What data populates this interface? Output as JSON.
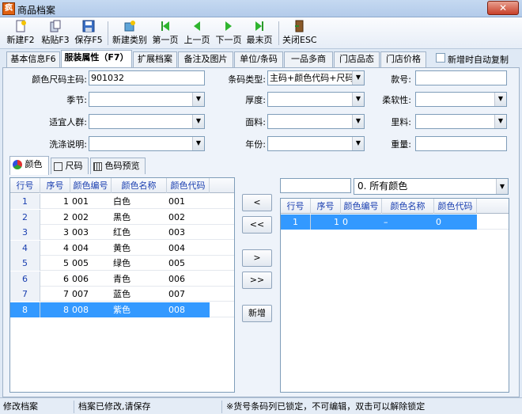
{
  "window": {
    "title": "商品档案",
    "app_icon": "疯",
    "close": "✕"
  },
  "toolbar": {
    "buttons": [
      {
        "label": "新建F2",
        "icon": "new-doc-icon"
      },
      {
        "label": "粘贴F3",
        "icon": "paste-icon"
      },
      {
        "label": "保存F5",
        "icon": "save-icon"
      },
      {
        "label": "新建类别",
        "icon": "new-category-icon"
      },
      {
        "label": "第一页",
        "icon": "first-page-icon"
      },
      {
        "label": "上一页",
        "icon": "prev-page-icon"
      },
      {
        "label": "下一页",
        "icon": "next-page-icon"
      },
      {
        "label": "最末页",
        "icon": "last-page-icon"
      },
      {
        "label": "关闭ESC",
        "icon": "close-door-icon"
      }
    ]
  },
  "tabs": [
    "基本信息F6",
    "服装属性（F7）",
    "扩展档案",
    "备注及图片",
    "单位/条码",
    "一品多商",
    "门店品态",
    "门店价格"
  ],
  "auto_copy_label": "新增时自动复制",
  "form": {
    "color_size_code_label": "颜色尺码主码:",
    "color_size_code_value": "901032",
    "barcode_type_label": "条码类型:",
    "barcode_type_value": "主码+颜色代码+尺码",
    "style_no_label": "款号:",
    "season_label": "季节:",
    "thickness_label": "厚度:",
    "softness_label": "柔软性:",
    "audience_label": "适宜人群:",
    "fabric_label": "面料:",
    "lining_label": "里料:",
    "wash_label": "洗涤说明:",
    "year_label": "年份:",
    "weight_label": "重量:"
  },
  "subtabs": [
    {
      "label": "颜色",
      "icon": "color-palette-icon"
    },
    {
      "label": "尺码",
      "icon": "ruler-icon"
    },
    {
      "label": "色码预览",
      "icon": "grid-preview-icon"
    }
  ],
  "left_grid": {
    "headers": [
      "行号",
      "序号",
      "颜色编号",
      "颜色名称",
      "颜色代码"
    ],
    "rows": [
      [
        "1",
        "1",
        "001",
        "白色",
        "001"
      ],
      [
        "2",
        "2",
        "002",
        "黑色",
        "002"
      ],
      [
        "3",
        "3",
        "003",
        "红色",
        "003"
      ],
      [
        "4",
        "4",
        "004",
        "黄色",
        "004"
      ],
      [
        "5",
        "5",
        "005",
        "绿色",
        "005"
      ],
      [
        "6",
        "6",
        "006",
        "青色",
        "006"
      ],
      [
        "7",
        "7",
        "007",
        "蓝色",
        "007"
      ],
      [
        "8",
        "8",
        "008",
        "紫色",
        "008"
      ]
    ]
  },
  "side_buttons": [
    "<",
    "<<",
    ">",
    ">>",
    "新增"
  ],
  "filter": {
    "value": "0. 所有颜色"
  },
  "right_grid": {
    "headers": [
      "行号",
      "序号",
      "颜色编号",
      "颜色名称",
      "颜色代码"
    ],
    "rows": [
      [
        "1",
        "1",
        "0",
        "–",
        "0"
      ]
    ]
  },
  "status": {
    "left": "修改档案",
    "mid": "档案已修改,请保存",
    "right": "※货号条码列已锁定，不可编辑，双击可以解除锁定"
  }
}
